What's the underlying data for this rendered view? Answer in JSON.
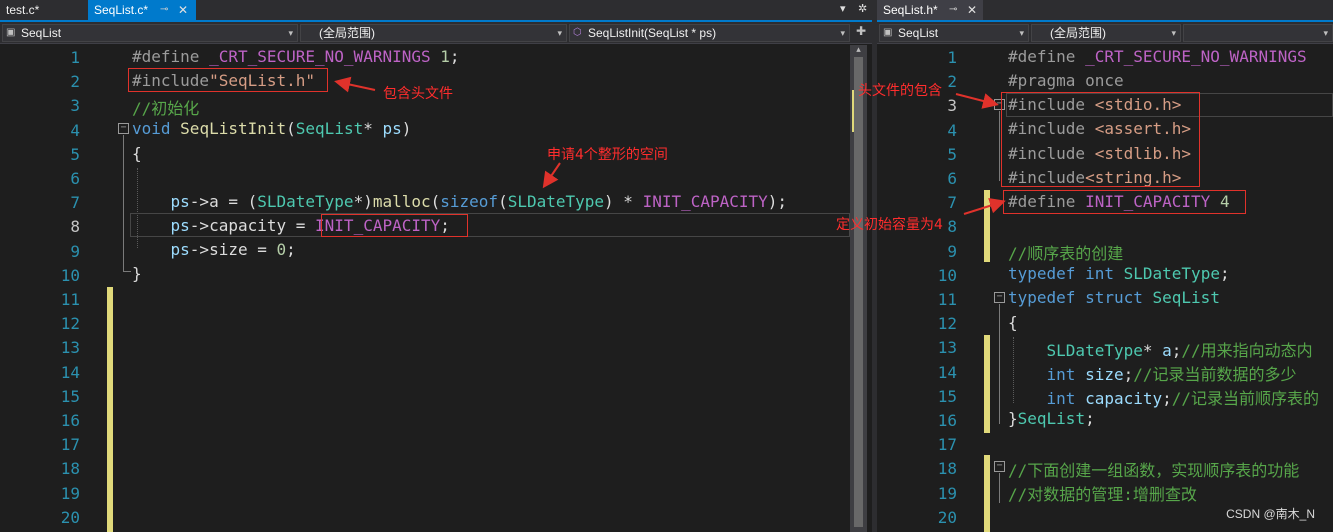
{
  "left": {
    "tabs": [
      {
        "label": "test.c*",
        "state": "normal"
      },
      {
        "label": "SeqList.c*",
        "state": "active"
      }
    ],
    "nav": {
      "scope_file": "SeqList",
      "scope": "(全局范围)",
      "member": "SeqListInit(SeqList * ps)"
    },
    "line_numbers": [
      "1",
      "2",
      "3",
      "4",
      "5",
      "6",
      "7",
      "8",
      "9",
      "10",
      "11",
      "12",
      "13",
      "14",
      "15",
      "16",
      "17",
      "18",
      "19",
      "20"
    ]
  },
  "right": {
    "tabs": [
      {
        "label": "SeqList.h*",
        "state": "current"
      }
    ],
    "nav": {
      "scope_file": "SeqList",
      "scope": "(全局范围)"
    },
    "line_numbers": [
      "1",
      "2",
      "3",
      "4",
      "5",
      "6",
      "7",
      "8",
      "9",
      "10",
      "11",
      "12",
      "13",
      "14",
      "15",
      "16",
      "17",
      "18",
      "19",
      "20"
    ]
  },
  "annotations": {
    "include_header": "包含头文件",
    "alloc_space": "申请4个整形的空间",
    "header_includes": "头文件的包含",
    "init_capacity": "定义初始容量为4"
  },
  "watermark": "CSDN @南木_N",
  "colors": {
    "editor_bg": "#1e1e1e",
    "tab_active": "#007acc",
    "annotation": "#e0322b",
    "line_number": "#2b91af",
    "change_bar": "#e0d97a"
  }
}
